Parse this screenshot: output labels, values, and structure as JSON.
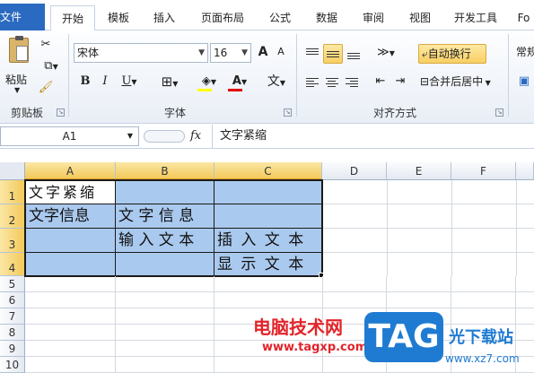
{
  "tabs": [
    "文件",
    "开始",
    "模板",
    "插入",
    "页面布局",
    "公式",
    "数据",
    "审阅",
    "视图",
    "开发工具",
    "Fo"
  ],
  "clipboard": {
    "paste": "粘贴",
    "label": "剪贴板"
  },
  "font": {
    "name": "宋体",
    "size": "16",
    "bold": "B",
    "italic": "I",
    "underline": "U",
    "grow": "A",
    "shrink": "A",
    "color_letter": "A",
    "wen": "文",
    "label": "字体"
  },
  "alignment": {
    "wrap": "自动换行",
    "merge": "合并后居中",
    "label": "对齐方式"
  },
  "number": {
    "format": "常规"
  },
  "formula_bar": {
    "name_box": "A1",
    "fx": "fx",
    "content": "文字紧缩"
  },
  "columns": [
    "A",
    "B",
    "C",
    "D",
    "E",
    "F"
  ],
  "rows": [
    "1",
    "2",
    "3",
    "4",
    "5",
    "6",
    "7",
    "8",
    "9",
    "10"
  ],
  "cells": {
    "a1": "文字紧缩",
    "a2": "文字信息",
    "b2": "文 字 信 息",
    "b3": "输 入 文 本",
    "c3": "插 入 文 本",
    "c4": "显 示 文 本"
  },
  "watermark": {
    "text": "电脑技术网",
    "url": "www.tagxp.com",
    "logo": "TAG",
    "side": "光下载站",
    "side_url": "www.xz7.com"
  },
  "colors": {
    "accent": "#2a6ac0",
    "selection": "#aac9ee",
    "highlight": "#f8cf62",
    "watermark_red": "#e2242a",
    "watermark_blue": "#1f7bd2"
  }
}
